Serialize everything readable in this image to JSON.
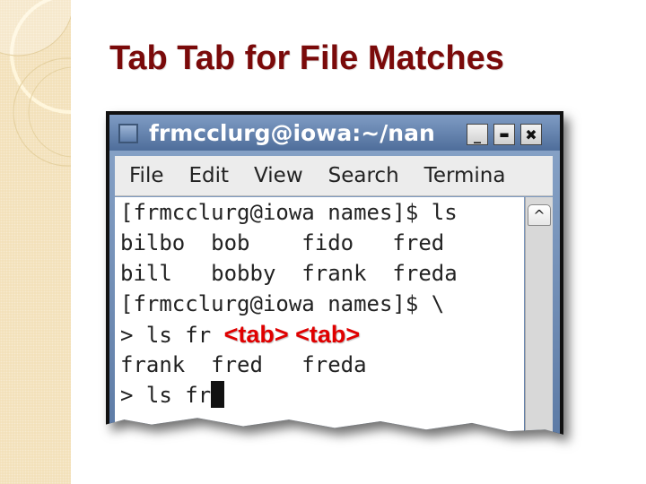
{
  "slide": {
    "title": "Tab Tab for File Matches"
  },
  "window": {
    "title": "frmcclurg@iowa:~/nan",
    "buttons": {
      "minimize": "_",
      "maximize": "▬",
      "close": "✖"
    },
    "menu": [
      "File",
      "Edit",
      "View",
      "Search",
      "Termina"
    ],
    "scroll_up_glyph": "^"
  },
  "terminal": {
    "lines": [
      "[frmcclurg@iowa names]$ ls",
      "bilbo  bob    fido   fred",
      "bill   bobby  frank  freda",
      "[frmcclurg@iowa names]$ \\",
      "> ls fr ",
      "frank  fred   freda",
      "> ls fr"
    ],
    "tab_annotation": "<tab> <tab>"
  },
  "colors": {
    "title": "#7a0a0a",
    "annotation": "#e00000",
    "titlebar": "#5c7aa5",
    "side_strip": "#f2dfb6"
  }
}
